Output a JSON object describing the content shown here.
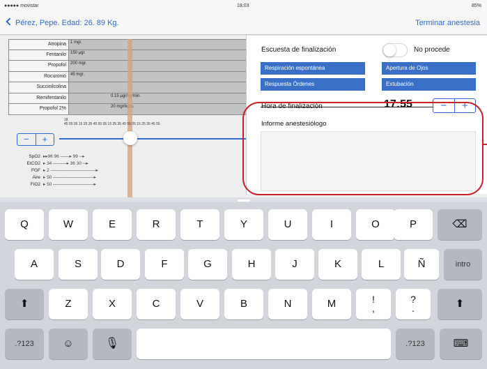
{
  "status_bar": {
    "carrier": "●●●●● movistar",
    "time": "18:03",
    "battery": "85%"
  },
  "nav": {
    "back_label": "Pérez, Pepe. Edad: 26. 89 Kg.",
    "end_label": "Terminar anestesia"
  },
  "drugs": [
    {
      "name": "Atropina",
      "dose": "1 mgr."
    },
    {
      "name": "Fentanilo",
      "dose": "150 μgr."
    },
    {
      "name": "Propofol",
      "dose": "200 mgr."
    },
    {
      "name": "Rocuronio",
      "dose": "45 mgr."
    },
    {
      "name": "Succinilcolina",
      "dose": ""
    },
    {
      "name": "Remifentanilo",
      "dose": "0.15 μgr/kg/min."
    },
    {
      "name": "Propofol 2%",
      "dose": "20 mgr/kg/h."
    }
  ],
  "timeline": {
    "hour": "18",
    "minutes": "45  55  05  15  25  35  45  55  05  15  25  35  45  55  05  15  25  35  45  55"
  },
  "stepper": {
    "minus": "−",
    "plus": "+"
  },
  "vitals": [
    {
      "label": "SpO2",
      "value": "▸▸96 96 ——▸ 99 ─▸"
    },
    {
      "label": "EtCO2",
      "value": "▸ 34 ———▸ 36 30 ─▸"
    },
    {
      "label": "FGF",
      "value": "▸ 2 ——————————▸"
    },
    {
      "label": "Aire",
      "value": "▸ 50 —————————▸"
    },
    {
      "label": "FiO2",
      "value": "▸ 50 —————————▸"
    }
  ],
  "panel": {
    "title": "Escuesta de finalización",
    "toggle_label": "No procede",
    "buttons": [
      "Respiración espontánea",
      "Apertura de Ojos",
      "Respuesta Órdenes",
      "Extubación"
    ],
    "hora_label": "Hora de finalización",
    "hora_value": "17:55",
    "informe_label": "Informe anestesiólogo"
  },
  "keyboard": {
    "row1": [
      "Q",
      "W",
      "E",
      "R",
      "T",
      "Y",
      "U",
      "I",
      "O",
      "P"
    ],
    "row2": [
      "A",
      "S",
      "D",
      "F",
      "G",
      "H",
      "J",
      "K",
      "L",
      "Ñ"
    ],
    "row3": [
      "Z",
      "X",
      "C",
      "V",
      "B",
      "N",
      "M"
    ],
    "exclaim": "!",
    "exclaim_sub": ",",
    "question": "?",
    "question_sub": ".",
    "intro": "intro",
    "numbers": ".?123",
    "backspace_icon": "⌫",
    "shift_icon": "⬆",
    "emoji_icon": "☺",
    "mic_icon": "🎙",
    "hide_keyboard_icon": "⌨"
  }
}
